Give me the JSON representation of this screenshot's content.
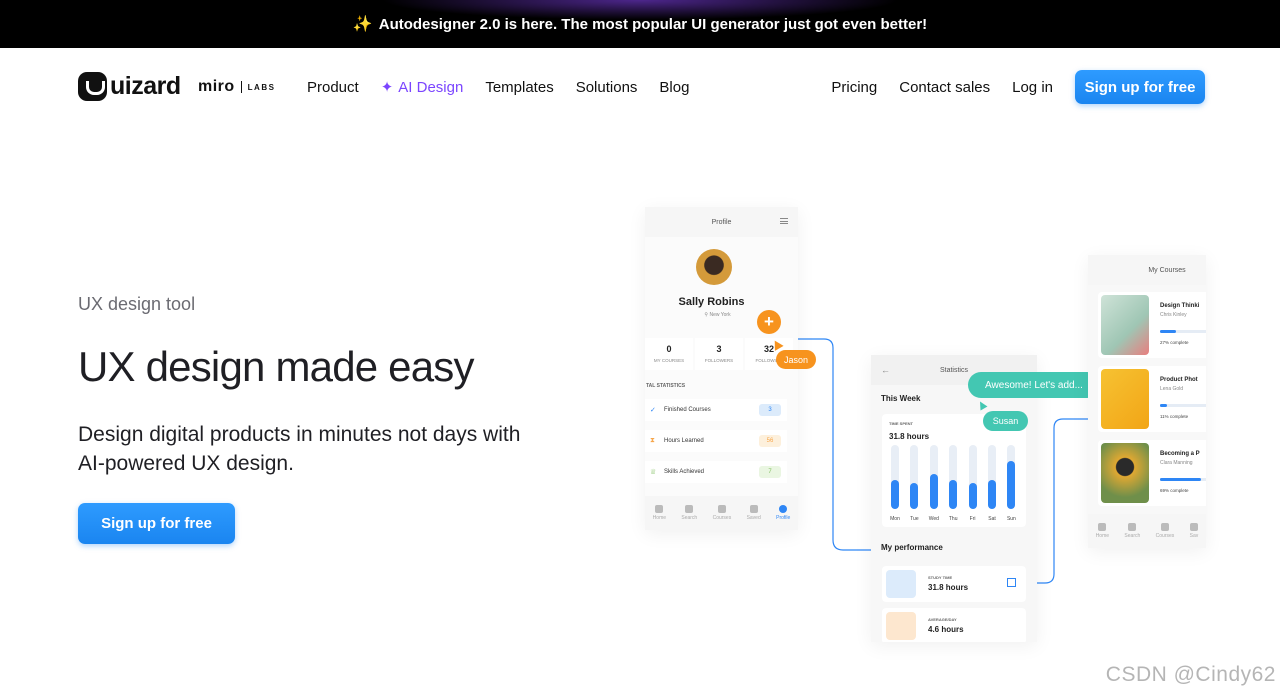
{
  "announcement": {
    "text": "Autodesigner 2.0 is here. The most popular UI generator just got even better!"
  },
  "nav": {
    "brand": "uizard",
    "partner": "miro",
    "partner_suffix": "LABS",
    "links": [
      "Product",
      "AI Design",
      "Templates",
      "Solutions",
      "Blog"
    ],
    "right_links": [
      "Pricing",
      "Contact sales",
      "Log in"
    ],
    "cta": "Sign up for free"
  },
  "hero": {
    "eyebrow": "UX design tool",
    "headline": "UX design made easy",
    "subcopy": "Design digital products in minutes not days with AI-powered UX design.",
    "cta": "Sign up for free"
  },
  "profile_card": {
    "title": "Profile",
    "name": "Sally Robins",
    "location": "New York",
    "stats": [
      {
        "num": "0",
        "label": "MY COURSES"
      },
      {
        "num": "3",
        "label": "FOLLOWERS"
      },
      {
        "num": "32",
        "label": "FOLLOWING"
      }
    ],
    "section": "TAL STATISTICS",
    "rows": [
      {
        "label": "Finished Courses",
        "value": "3",
        "bg": "#dcebfb",
        "color": "#2e86f5"
      },
      {
        "label": "Hours Learned",
        "value": "56",
        "bg": "#fdf0dc",
        "color": "#f7a64a"
      },
      {
        "label": "Skills Achieved",
        "value": "7",
        "bg": "#eaf6e2",
        "color": "#7cbd5a"
      }
    ],
    "tabs": [
      "Home",
      "Search",
      "Courses",
      "Saved",
      "Profile"
    ]
  },
  "collab": {
    "user1": "Jason",
    "user2": "Susan",
    "message": "Awesome! Let's add..."
  },
  "stats_card": {
    "title": "Statistics",
    "week": "This Week",
    "time_label": "TIME SPENT",
    "time_value": "31.8 hours",
    "chart_data": {
      "type": "bar",
      "categories": [
        "Mon",
        "Tue",
        "Wed",
        "Thu",
        "Fri",
        "Sat",
        "Sun"
      ],
      "values": [
        0.45,
        0.4,
        0.55,
        0.45,
        0.4,
        0.45,
        0.75
      ]
    },
    "perf_title": "My performance",
    "perf_rows": [
      {
        "label": "STUDY TIME",
        "value": "31.8 hours",
        "bg": "#dcebfb"
      },
      {
        "label": "AVERAGE/DAY",
        "value": "4.6 hours",
        "bg": "#fde7cf"
      }
    ]
  },
  "courses_card": {
    "title": "My Courses",
    "items": [
      {
        "title": "Design Thinki",
        "author": "Chris Kinley",
        "progress": 0.27,
        "progress_label": "27% complete"
      },
      {
        "title": "Product Phot",
        "author": "Lena Gold",
        "progress": 0.11,
        "progress_label": "11% complete"
      },
      {
        "title": "Becoming a P",
        "author": "Clara Manning",
        "progress": 0.69,
        "progress_label": "69% complete"
      }
    ],
    "tabs": [
      "Home",
      "Search",
      "Courses",
      "Sav"
    ]
  },
  "watermark": "CSDN @Cindy62",
  "colors": {
    "accent": "#1a85f0",
    "ai": "#7b45ff",
    "orange": "#f7931e",
    "teal": "#43c7b2"
  }
}
